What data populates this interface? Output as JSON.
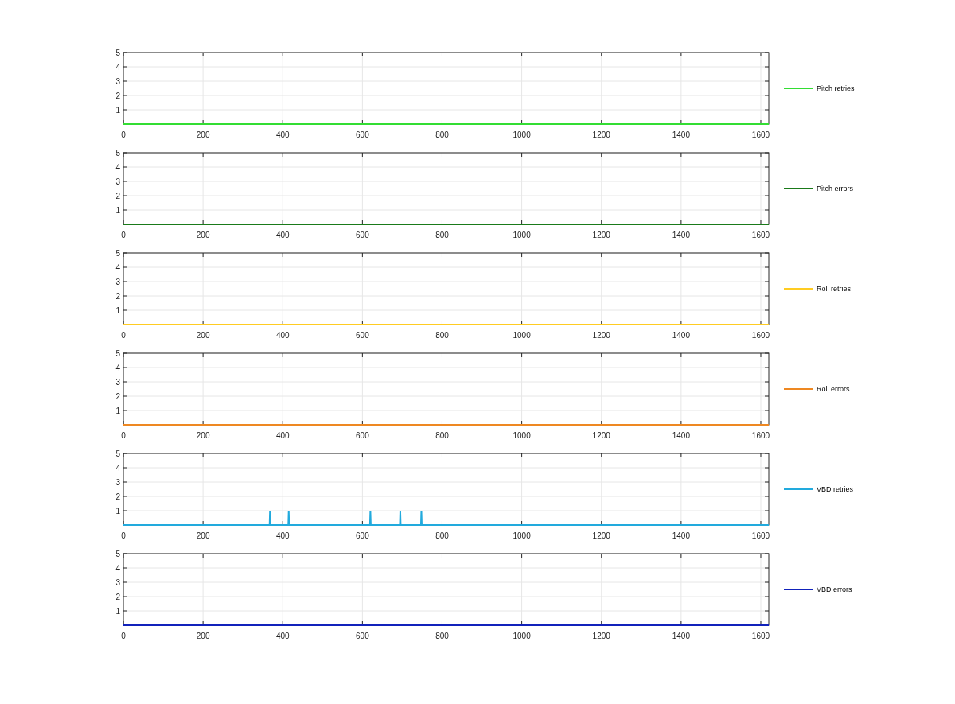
{
  "charts": [
    {
      "chart_data": {
        "type": "line",
        "grid": true,
        "x": [
          0,
          1620
        ],
        "xlim": [
          0,
          1620
        ],
        "ylim": [
          0,
          5
        ],
        "xticks": [
          0,
          200,
          400,
          600,
          800,
          1000,
          1200,
          1400,
          1600
        ],
        "yticks": [
          1,
          2,
          3,
          4,
          5
        ],
        "series": [
          {
            "name": "Pitch retries",
            "color": "#33dd33",
            "values": [
              0,
              0
            ]
          }
        ]
      }
    },
    {
      "chart_data": {
        "type": "line",
        "grid": true,
        "x": [
          0,
          1620
        ],
        "xlim": [
          0,
          1620
        ],
        "ylim": [
          0,
          5
        ],
        "xticks": [
          0,
          200,
          400,
          600,
          800,
          1000,
          1200,
          1400,
          1600
        ],
        "yticks": [
          1,
          2,
          3,
          4,
          5
        ],
        "series": [
          {
            "name": "Pitch errors",
            "color": "#1a7a1a",
            "values": [
              0,
              0
            ]
          }
        ]
      }
    },
    {
      "chart_data": {
        "type": "line",
        "grid": true,
        "x": [
          0,
          1620
        ],
        "xlim": [
          0,
          1620
        ],
        "ylim": [
          0,
          5
        ],
        "xticks": [
          0,
          200,
          400,
          600,
          800,
          1000,
          1200,
          1400,
          1600
        ],
        "yticks": [
          1,
          2,
          3,
          4,
          5
        ],
        "series": [
          {
            "name": "Roll retries",
            "color": "#ffcc22",
            "values": [
              0,
              0
            ]
          }
        ]
      }
    },
    {
      "chart_data": {
        "type": "line",
        "grid": true,
        "x": [
          0,
          1620
        ],
        "xlim": [
          0,
          1620
        ],
        "ylim": [
          0,
          5
        ],
        "xticks": [
          0,
          200,
          400,
          600,
          800,
          1000,
          1200,
          1400,
          1600
        ],
        "yticks": [
          1,
          2,
          3,
          4,
          5
        ],
        "series": [
          {
            "name": "Roll errors",
            "color": "#ee8822",
            "values": [
              0,
              0
            ]
          }
        ]
      }
    },
    {
      "chart_data": {
        "type": "line",
        "grid": true,
        "x": [
          0,
          367,
          368,
          369,
          414,
          415,
          416,
          619,
          620,
          621,
          694,
          695,
          696,
          747,
          748,
          749,
          1620
        ],
        "xlim": [
          0,
          1620
        ],
        "ylim": [
          0,
          5
        ],
        "xticks": [
          0,
          200,
          400,
          600,
          800,
          1000,
          1200,
          1400,
          1600
        ],
        "yticks": [
          1,
          2,
          3,
          4,
          5
        ],
        "series": [
          {
            "name": "VBD retries",
            "color": "#22aadd",
            "values": [
              0,
              0,
              1,
              0,
              0,
              1,
              0,
              0,
              1,
              0,
              0,
              1,
              0,
              0,
              1,
              0,
              0
            ]
          }
        ]
      }
    },
    {
      "chart_data": {
        "type": "line",
        "grid": true,
        "x": [
          0,
          1620
        ],
        "xlim": [
          0,
          1620
        ],
        "ylim": [
          0,
          5
        ],
        "xticks": [
          0,
          200,
          400,
          600,
          800,
          1000,
          1200,
          1400,
          1600
        ],
        "yticks": [
          1,
          2,
          3,
          4,
          5
        ],
        "series": [
          {
            "name": "VBD errors",
            "color": "#1122bb",
            "values": [
              0,
              0
            ]
          }
        ]
      }
    }
  ]
}
